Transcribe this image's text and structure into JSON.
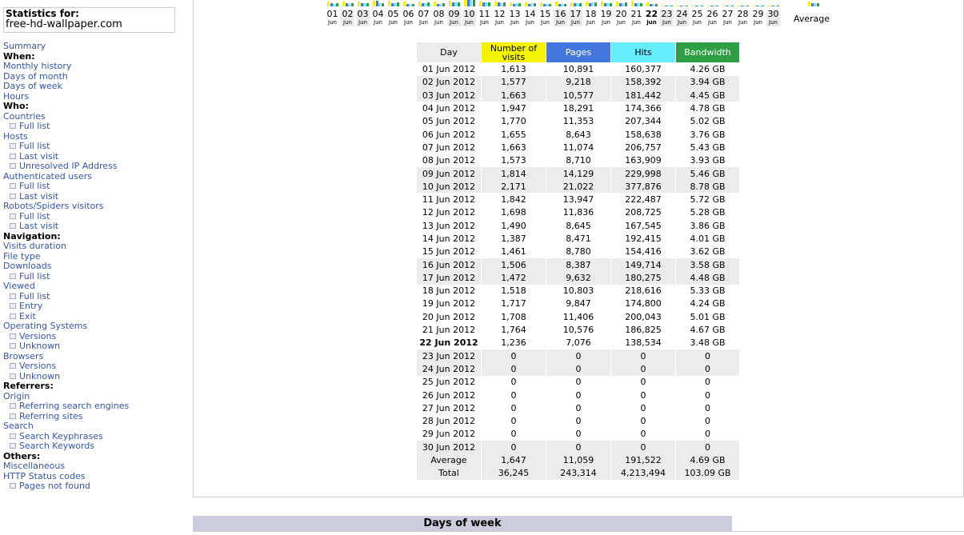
{
  "header": {
    "stats_for_label": "Statistics for:",
    "site": "free-hd-wallpaper.com"
  },
  "menu": [
    {
      "type": "link",
      "label": "Summary",
      "name": "menu-summary"
    },
    {
      "type": "head",
      "label": "When:",
      "name": "menu-section-when"
    },
    {
      "type": "link",
      "label": "Monthly history",
      "name": "menu-monthly-history"
    },
    {
      "type": "link",
      "label": "Days of month",
      "name": "menu-days-of-month"
    },
    {
      "type": "link",
      "label": "Days of week",
      "name": "menu-days-of-week"
    },
    {
      "type": "link",
      "label": "Hours",
      "name": "menu-hours"
    },
    {
      "type": "head",
      "label": "Who:",
      "name": "menu-section-who"
    },
    {
      "type": "link",
      "label": "Countries",
      "name": "menu-countries"
    },
    {
      "type": "sub",
      "label": "Full list",
      "name": "menu-countries-full-list"
    },
    {
      "type": "link",
      "label": "Hosts",
      "name": "menu-hosts"
    },
    {
      "type": "sub",
      "label": "Full list",
      "name": "menu-hosts-full-list"
    },
    {
      "type": "sub",
      "label": "Last visit",
      "name": "menu-hosts-last-visit"
    },
    {
      "type": "sub",
      "label": "Unresolved IP Address",
      "name": "menu-hosts-unresolved-ip"
    },
    {
      "type": "link",
      "label": "Authenticated users",
      "name": "menu-authenticated-users"
    },
    {
      "type": "sub",
      "label": "Full list",
      "name": "menu-auth-full-list"
    },
    {
      "type": "sub",
      "label": "Last visit",
      "name": "menu-auth-last-visit"
    },
    {
      "type": "link",
      "label": "Robots/Spiders visitors",
      "name": "menu-robots"
    },
    {
      "type": "sub",
      "label": "Full list",
      "name": "menu-robots-full-list"
    },
    {
      "type": "sub",
      "label": "Last visit",
      "name": "menu-robots-last-visit"
    },
    {
      "type": "head",
      "label": "Navigation:",
      "name": "menu-section-navigation"
    },
    {
      "type": "link",
      "label": "Visits duration",
      "name": "menu-visits-duration"
    },
    {
      "type": "link",
      "label": "File type",
      "name": "menu-file-type"
    },
    {
      "type": "link",
      "label": "Downloads",
      "name": "menu-downloads"
    },
    {
      "type": "sub",
      "label": "Full list",
      "name": "menu-downloads-full-list"
    },
    {
      "type": "link",
      "label": "Viewed",
      "name": "menu-viewed"
    },
    {
      "type": "sub",
      "label": "Full list",
      "name": "menu-viewed-full-list"
    },
    {
      "type": "sub",
      "label": "Entry",
      "name": "menu-viewed-entry"
    },
    {
      "type": "sub",
      "label": "Exit",
      "name": "menu-viewed-exit"
    },
    {
      "type": "link",
      "label": "Operating Systems",
      "name": "menu-operating-systems"
    },
    {
      "type": "sub",
      "label": "Versions",
      "name": "menu-os-versions"
    },
    {
      "type": "sub",
      "label": "Unknown",
      "name": "menu-os-unknown"
    },
    {
      "type": "link",
      "label": "Browsers",
      "name": "menu-browsers"
    },
    {
      "type": "sub",
      "label": "Versions",
      "name": "menu-browsers-versions"
    },
    {
      "type": "sub",
      "label": "Unknown",
      "name": "menu-browsers-unknown"
    },
    {
      "type": "head",
      "label": "Referrers:",
      "name": "menu-section-referrers"
    },
    {
      "type": "link",
      "label": "Origin",
      "name": "menu-origin"
    },
    {
      "type": "sub",
      "label": "Referring search engines",
      "name": "menu-referring-search-engines"
    },
    {
      "type": "sub",
      "label": "Referring sites",
      "name": "menu-referring-sites"
    },
    {
      "type": "link",
      "label": "Search",
      "name": "menu-search"
    },
    {
      "type": "sub",
      "label": "Search Keyphrases",
      "name": "menu-search-keyphrases"
    },
    {
      "type": "sub",
      "label": "Search Keywords",
      "name": "menu-search-keywords"
    },
    {
      "type": "head",
      "label": "Others:",
      "name": "menu-section-others"
    },
    {
      "type": "link",
      "label": "Miscellaneous",
      "name": "menu-miscellaneous"
    },
    {
      "type": "link",
      "label": "HTTP Status codes",
      "name": "menu-http-status-codes"
    },
    {
      "type": "sub",
      "label": "Pages not found",
      "name": "menu-pages-not-found"
    }
  ],
  "day_axis": {
    "days": [
      "01",
      "02",
      "03",
      "04",
      "05",
      "06",
      "07",
      "08",
      "09",
      "10",
      "11",
      "12",
      "13",
      "14",
      "15",
      "16",
      "17",
      "18",
      "19",
      "20",
      "21",
      "22",
      "23",
      "24",
      "25",
      "26",
      "27",
      "28",
      "29",
      "30"
    ],
    "month": "Jun",
    "weekend_days": [
      "02",
      "03",
      "09",
      "10",
      "16",
      "17",
      "23",
      "24",
      "30"
    ],
    "current_day": "22",
    "average_label": "Average"
  },
  "colors": {
    "visits": "#f4f400",
    "pages": "#4477dd",
    "hits": "#66eeff",
    "bandwidth": "#2e9e44",
    "shade": "#ececec"
  },
  "table": {
    "headers": {
      "day": "Day",
      "visits": "Number of visits",
      "pages": "Pages",
      "hits": "Hits",
      "bandwidth": "Bandwidth"
    },
    "rows": [
      {
        "day": "01 Jun 2012",
        "visits": "1,613",
        "pages": "10,891",
        "hits": "160,377",
        "bandwidth": "4.26 GB"
      },
      {
        "day": "02 Jun 2012",
        "visits": "1,577",
        "pages": "9,218",
        "hits": "158,392",
        "bandwidth": "3.94 GB"
      },
      {
        "day": "03 Jun 2012",
        "visits": "1,663",
        "pages": "10,577",
        "hits": "181,442",
        "bandwidth": "4.45 GB"
      },
      {
        "day": "04 Jun 2012",
        "visits": "1,947",
        "pages": "18,291",
        "hits": "174,366",
        "bandwidth": "4.78 GB"
      },
      {
        "day": "05 Jun 2012",
        "visits": "1,770",
        "pages": "11,353",
        "hits": "207,344",
        "bandwidth": "5.02 GB"
      },
      {
        "day": "06 Jun 2012",
        "visits": "1,655",
        "pages": "8,643",
        "hits": "158,638",
        "bandwidth": "3.76 GB"
      },
      {
        "day": "07 Jun 2012",
        "visits": "1,663",
        "pages": "11,074",
        "hits": "206,757",
        "bandwidth": "5.43 GB"
      },
      {
        "day": "08 Jun 2012",
        "visits": "1,573",
        "pages": "8,710",
        "hits": "163,909",
        "bandwidth": "3.93 GB"
      },
      {
        "day": "09 Jun 2012",
        "visits": "1,814",
        "pages": "14,129",
        "hits": "229,998",
        "bandwidth": "5.46 GB"
      },
      {
        "day": "10 Jun 2012",
        "visits": "2,171",
        "pages": "21,022",
        "hits": "377,876",
        "bandwidth": "8.78 GB"
      },
      {
        "day": "11 Jun 2012",
        "visits": "1,842",
        "pages": "13,947",
        "hits": "222,487",
        "bandwidth": "5.72 GB"
      },
      {
        "day": "12 Jun 2012",
        "visits": "1,698",
        "pages": "11,836",
        "hits": "208,725",
        "bandwidth": "5.28 GB"
      },
      {
        "day": "13 Jun 2012",
        "visits": "1,490",
        "pages": "8,645",
        "hits": "167,545",
        "bandwidth": "3.86 GB"
      },
      {
        "day": "14 Jun 2012",
        "visits": "1,387",
        "pages": "8,471",
        "hits": "192,415",
        "bandwidth": "4.01 GB"
      },
      {
        "day": "15 Jun 2012",
        "visits": "1,461",
        "pages": "8,780",
        "hits": "154,416",
        "bandwidth": "3.62 GB"
      },
      {
        "day": "16 Jun 2012",
        "visits": "1,506",
        "pages": "8,387",
        "hits": "149,714",
        "bandwidth": "3.58 GB"
      },
      {
        "day": "17 Jun 2012",
        "visits": "1,472",
        "pages": "9,632",
        "hits": "180,275",
        "bandwidth": "4.48 GB"
      },
      {
        "day": "18 Jun 2012",
        "visits": "1,518",
        "pages": "10,803",
        "hits": "218,616",
        "bandwidth": "5.33 GB"
      },
      {
        "day": "19 Jun 2012",
        "visits": "1,717",
        "pages": "9,847",
        "hits": "174,800",
        "bandwidth": "4.24 GB"
      },
      {
        "day": "20 Jun 2012",
        "visits": "1,708",
        "pages": "11,406",
        "hits": "200,043",
        "bandwidth": "5.01 GB"
      },
      {
        "day": "21 Jun 2012",
        "visits": "1,764",
        "pages": "10,576",
        "hits": "186,825",
        "bandwidth": "4.67 GB"
      },
      {
        "day": "22 Jun 2012",
        "visits": "1,236",
        "pages": "7,076",
        "hits": "138,534",
        "bandwidth": "3.48 GB"
      },
      {
        "day": "23 Jun 2012",
        "visits": "0",
        "pages": "0",
        "hits": "0",
        "bandwidth": "0"
      },
      {
        "day": "24 Jun 2012",
        "visits": "0",
        "pages": "0",
        "hits": "0",
        "bandwidth": "0"
      },
      {
        "day": "25 Jun 2012",
        "visits": "0",
        "pages": "0",
        "hits": "0",
        "bandwidth": "0"
      },
      {
        "day": "26 Jun 2012",
        "visits": "0",
        "pages": "0",
        "hits": "0",
        "bandwidth": "0"
      },
      {
        "day": "27 Jun 2012",
        "visits": "0",
        "pages": "0",
        "hits": "0",
        "bandwidth": "0"
      },
      {
        "day": "28 Jun 2012",
        "visits": "0",
        "pages": "0",
        "hits": "0",
        "bandwidth": "0"
      },
      {
        "day": "29 Jun 2012",
        "visits": "0",
        "pages": "0",
        "hits": "0",
        "bandwidth": "0"
      },
      {
        "day": "30 Jun 2012",
        "visits": "0",
        "pages": "0",
        "hits": "0",
        "bandwidth": "0"
      }
    ],
    "shaded_days": [
      "02 Jun 2012",
      "03 Jun 2012",
      "09 Jun 2012",
      "10 Jun 2012",
      "16 Jun 2012",
      "17 Jun 2012",
      "23 Jun 2012",
      "24 Jun 2012",
      "30 Jun 2012"
    ],
    "current_day": "22 Jun 2012",
    "average": {
      "label": "Average",
      "visits": "1,647",
      "pages": "11,059",
      "hits": "191,522",
      "bandwidth": "4.69 GB"
    },
    "total": {
      "label": "Total",
      "visits": "36,245",
      "pages": "243,314",
      "hits": "4,213,494",
      "bandwidth": "103.09 GB"
    }
  },
  "next_section": {
    "title": "Days of week"
  }
}
